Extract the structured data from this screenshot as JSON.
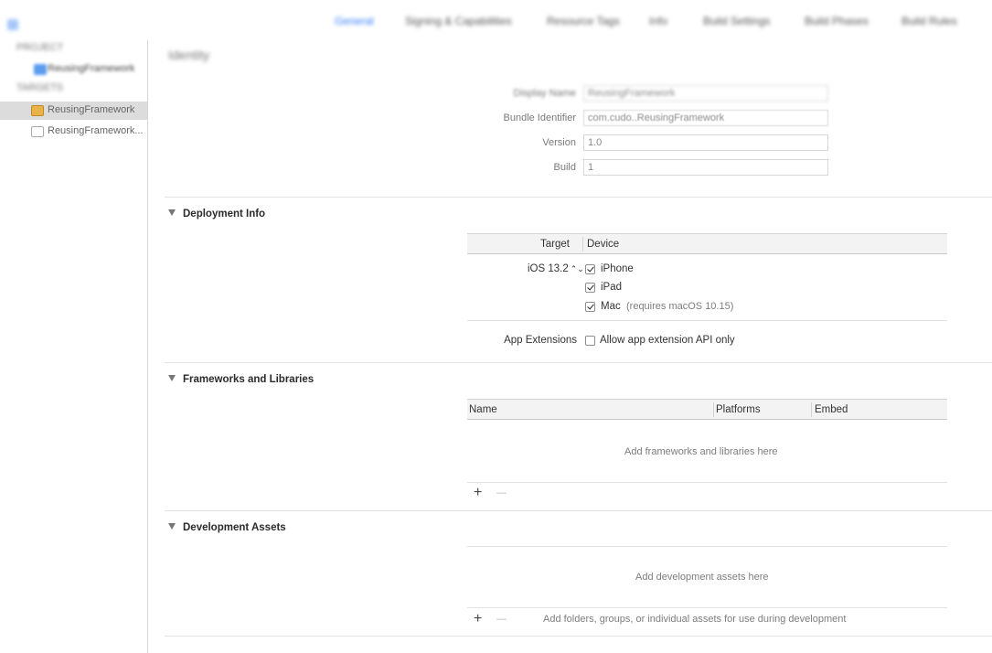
{
  "tabs": [
    "General",
    "Signing & Capabilities",
    "Resource Tags",
    "Info",
    "Build Settings",
    "Build Phases",
    "Build Rules"
  ],
  "sidebar": {
    "project_header": "PROJECT",
    "project_item": "ReusingFramework",
    "targets_header": "TARGETS",
    "targets": [
      "ReusingFramework",
      "ReusingFramework..."
    ]
  },
  "identity": {
    "title": "Identity",
    "rows": [
      {
        "label": "Display Name",
        "value": "ReusingFramework"
      },
      {
        "label": "Bundle Identifier",
        "value": "com.cudo..ReusingFramework"
      },
      {
        "label": "Version",
        "value": "1.0"
      },
      {
        "label": "Build",
        "value": "1"
      }
    ]
  },
  "deployment": {
    "title": "Deployment Info",
    "col_target": "Target",
    "col_device": "Device",
    "target_value": "iOS 13.2",
    "stepper_glyph": "⌃⌄",
    "devices": [
      {
        "label": "iPhone",
        "checked": true,
        "note": ""
      },
      {
        "label": "iPad",
        "checked": true,
        "note": ""
      },
      {
        "label": "Mac",
        "checked": true,
        "note": "(requires macOS 10.15)"
      }
    ],
    "app_ext_label": "App Extensions",
    "app_ext_option": "Allow app extension API only",
    "app_ext_checked": false
  },
  "frameworks": {
    "title": "Frameworks and Libraries",
    "col_name": "Name",
    "col_platforms": "Platforms",
    "col_embed": "Embed",
    "empty": "Add frameworks and libraries here",
    "add": "+",
    "remove": "—"
  },
  "dev_assets": {
    "title": "Development Assets",
    "empty": "Add development assets here",
    "hint": "Add folders, groups, or individual assets for use during development",
    "add": "+",
    "remove": "—"
  },
  "colors": {
    "accent": "#2f7cf6",
    "selection": "#dcdcdc",
    "folder": "#e9b34a"
  }
}
